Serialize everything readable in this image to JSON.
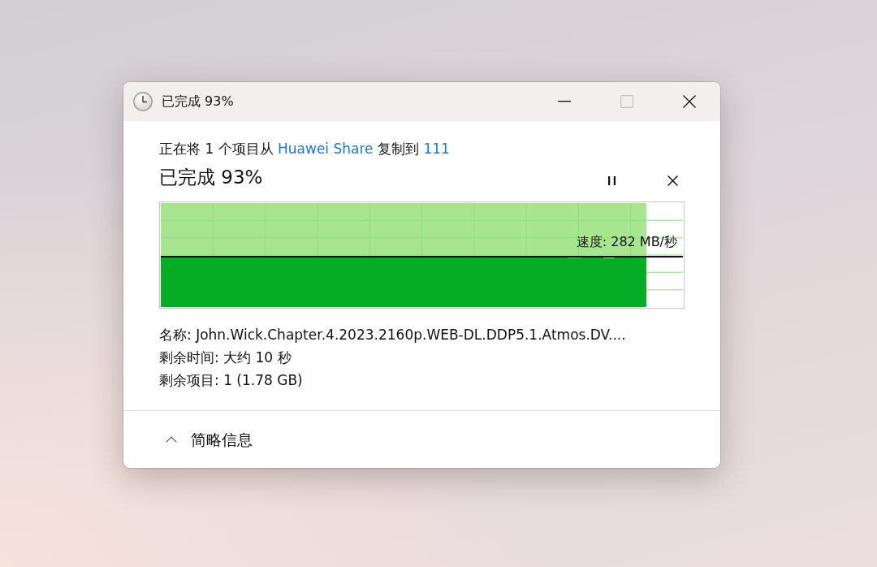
{
  "window": {
    "title": "已完成 93%",
    "buttons": [
      {
        "kind": "minimize",
        "disabled": false
      },
      {
        "kind": "maximize",
        "disabled": true
      },
      {
        "kind": "close",
        "disabled": false
      }
    ]
  },
  "copy": {
    "description": [
      {
        "kind": "text",
        "text": "正在将 1 个项目从"
      },
      {
        "kind": "link",
        "text": "Huawei Share"
      },
      {
        "kind": "text",
        "text": "复制到"
      },
      {
        "kind": "link",
        "text": "111"
      }
    ],
    "progress_title": "已完成 93%",
    "controls": [
      {
        "kind": "pause"
      },
      {
        "kind": "cancel"
      }
    ],
    "graph": {
      "level": 0.93,
      "speed": "速度: 282 MB/秒"
    },
    "details": [
      "名称: John.Wick.Chapter.4.2023.2160p.WEB-DL.DDP5.1.Atmos.DV....",
      "剩余时间: 大约 10 秒",
      "剩余项目: 1 (1.78 GB)"
    ]
  },
  "footer": {
    "toggle": {
      "label": "简略信息",
      "expanded": true
    }
  }
}
